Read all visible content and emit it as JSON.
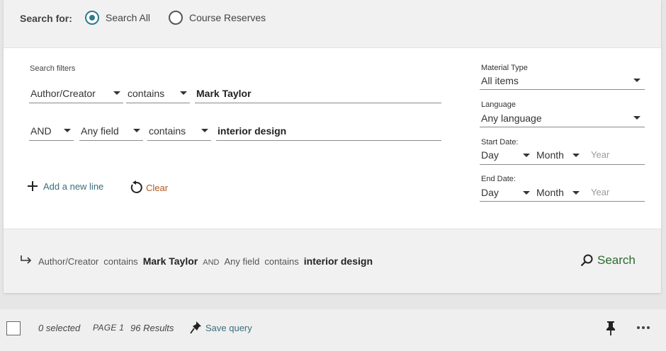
{
  "search_for": {
    "label": "Search for:",
    "options": [
      {
        "label": "Search All",
        "selected": true
      },
      {
        "label": "Course Reserves",
        "selected": false
      }
    ]
  },
  "filters": {
    "title": "Search filters",
    "row1": {
      "field": "Author/Creator",
      "operator": "contains",
      "value": "Mark Taylor"
    },
    "row2": {
      "boolean": "AND",
      "field": "Any field",
      "operator": "contains",
      "value": "interior design"
    },
    "add_line_label": "Add a new line",
    "clear_label": "Clear"
  },
  "side": {
    "material_type": {
      "label": "Material Type",
      "value": "All items"
    },
    "language": {
      "label": "Language",
      "value": "Any language"
    },
    "start_date": {
      "label": "Start Date:",
      "day": "Day",
      "month": "Month",
      "year_placeholder": "Year"
    },
    "end_date": {
      "label": "End Date:",
      "day": "Day",
      "month": "Month",
      "year_placeholder": "Year"
    }
  },
  "summary": {
    "field1": "Author/Creator",
    "op1": "contains",
    "value1": "Mark Taylor",
    "bool": "AND",
    "field2": "Any field",
    "op2": "contains",
    "value2": "interior design",
    "search_label": "Search"
  },
  "results_bar": {
    "selected": "0 selected",
    "page": "PAGE 1",
    "results": "96 Results",
    "save_query": "Save query"
  },
  "colors": {
    "accent": "#2f7a8a",
    "search_green": "#2a6b2a",
    "clear_orange": "#b0561e",
    "link_blue": "#3a6d7c"
  },
  "icons": {
    "add": "plus-icon",
    "clear": "reset-icon",
    "search": "magnifier-icon",
    "pin": "pushpin-icon",
    "more": "ellipsis-icon",
    "summary_arrow": "return-arrow-icon"
  }
}
